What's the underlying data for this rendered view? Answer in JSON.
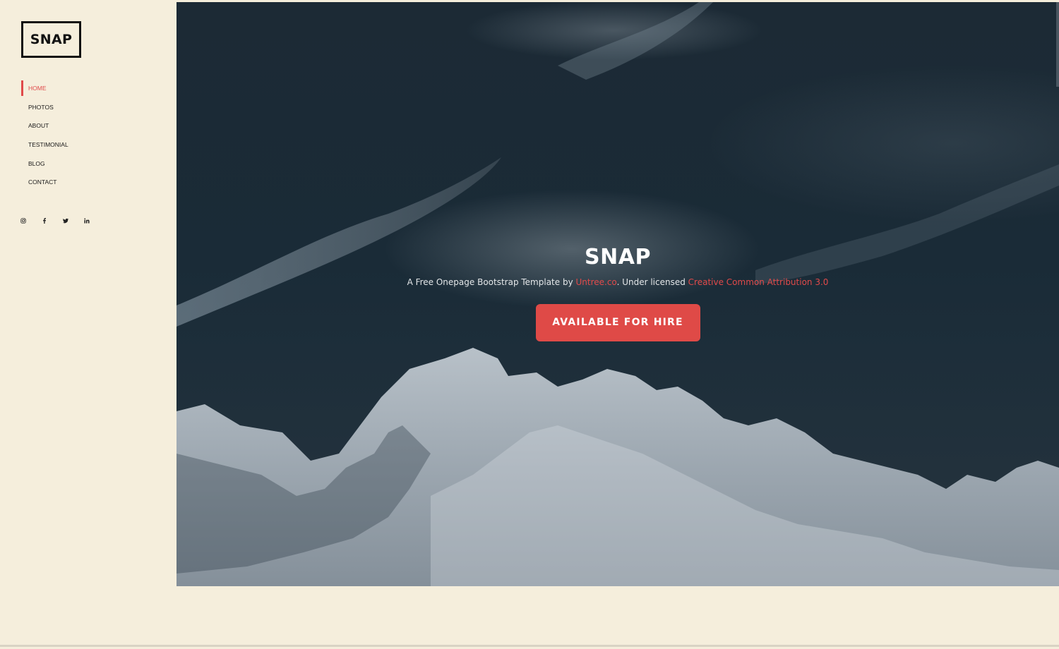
{
  "brand": {
    "logo_text": "SNAP"
  },
  "nav": {
    "items": [
      {
        "label": "HOME",
        "active": true
      },
      {
        "label": "PHOTOS",
        "active": false
      },
      {
        "label": "ABOUT",
        "active": false
      },
      {
        "label": "TESTIMONIAL",
        "active": false
      },
      {
        "label": "BLOG",
        "active": false
      },
      {
        "label": "CONTACT",
        "active": false
      }
    ]
  },
  "social": {
    "icons": [
      "instagram-icon",
      "facebook-icon",
      "twitter-icon",
      "linkedin-icon"
    ]
  },
  "hero": {
    "title": "SNAP",
    "subtitle_prefix": "A Free Onepage Bootstrap Template by ",
    "author_link": "Untree.co",
    "subtitle_middle": ". Under licensed ",
    "license_link": "Creative Common Attribution 3.0",
    "cta_label": "AVAILABLE FOR HIRE"
  },
  "colors": {
    "accent": "#df4a47",
    "sidebar_bg": "#f5eedc",
    "hero_bg": "#1c2a35"
  }
}
